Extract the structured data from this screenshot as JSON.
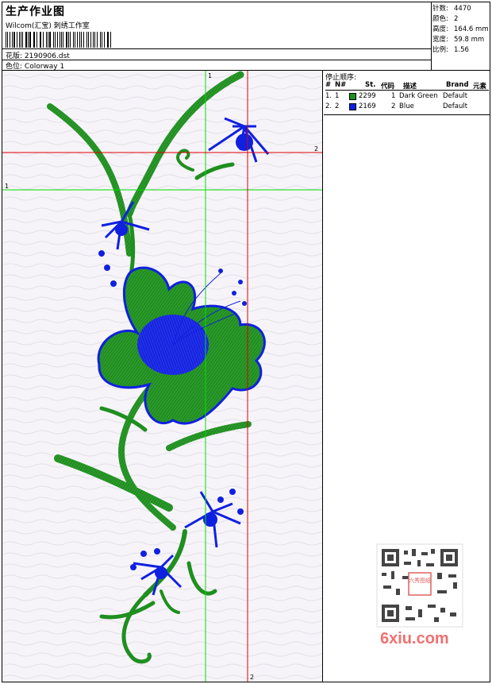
{
  "header": {
    "title": "生产作业图",
    "company": "Wilcom(汇宝) 刺绣工作室",
    "design_label": "花版:",
    "design_value": "2190906.dst",
    "colorway_label": "色位:",
    "colorway_value": "Colorway 1"
  },
  "stats": [
    {
      "label": "针数:",
      "value": "4470"
    },
    {
      "label": "颜色:",
      "value": "2"
    },
    {
      "label": "高度:",
      "value": "164.6 mm"
    },
    {
      "label": "宽度:",
      "value": "59.8 mm"
    },
    {
      "label": "比例:",
      "value": "1.56"
    }
  ],
  "stop_sequence": {
    "title": "停止顺序:",
    "columns": [
      "#",
      "N#",
      "St.",
      "代码",
      "描述",
      "Brand",
      "元素"
    ],
    "rows": [
      {
        "index": "1.",
        "needle": "1",
        "stitches": "2299",
        "code": "1",
        "description": "Dark Green",
        "brand": "Default",
        "color": "#1f8f1f"
      },
      {
        "index": "2.",
        "needle": "2",
        "stitches": "2169",
        "code": "2",
        "description": "Blue",
        "brand": "Default",
        "color": "#1020e0"
      }
    ]
  },
  "guides": {
    "green_label_top": "1",
    "green_label_left": "1",
    "red_label_right": "2",
    "red_label_bottom": "2",
    "green_color": "#00e000",
    "red_color": "#e00000"
  },
  "watermark": {
    "text": "6xiu.com",
    "seal_text": "六秀图纸"
  },
  "colors": {
    "thread_green": "#1f8f1f",
    "thread_blue": "#1020e0"
  }
}
